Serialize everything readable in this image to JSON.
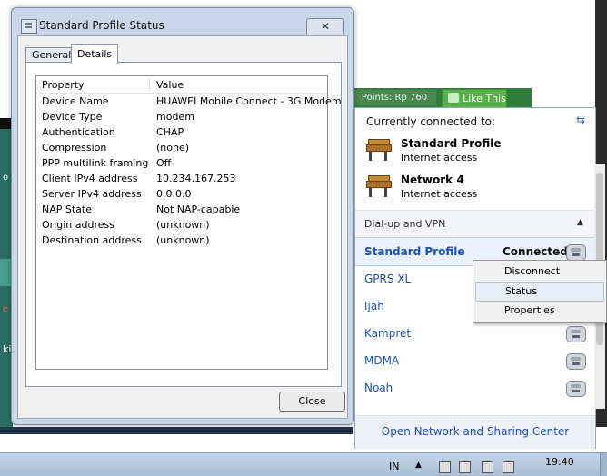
{
  "background": {
    "points_badge": "Points: Rp 760",
    "like_button": "Like This",
    "side_mark_1": "ki",
    "side_mark_2": "o",
    "side_mark_3": "e"
  },
  "dialog": {
    "title": "Standard Profile Status",
    "close_glyph": "✕",
    "tabs": [
      "General",
      "Details"
    ],
    "columns": {
      "property": "Property",
      "value": "Value"
    },
    "rows": [
      {
        "property": "Device Name",
        "value": "HUAWEI Mobile Connect - 3G Modem"
      },
      {
        "property": "Device Type",
        "value": "modem"
      },
      {
        "property": "Authentication",
        "value": "CHAP"
      },
      {
        "property": "Compression",
        "value": "(none)"
      },
      {
        "property": "PPP multilink framing",
        "value": "Off"
      },
      {
        "property": "Client IPv4 address",
        "value": "10.234.167.253"
      },
      {
        "property": "Server IPv4 address",
        "value": "0.0.0.0"
      },
      {
        "property": "NAP State",
        "value": "Not NAP-capable"
      },
      {
        "property": "Origin address",
        "value": "(unknown)"
      },
      {
        "property": "Destination address",
        "value": "(unknown)"
      }
    ],
    "close_label": "Close"
  },
  "flyout": {
    "heading": "Currently connected to:",
    "refresh_glyph": "⇆",
    "networks": [
      {
        "name": "Standard Profile",
        "status": "Internet access"
      },
      {
        "name": "Network  4",
        "status": "Internet access"
      }
    ],
    "section_label": "Dial-up and VPN",
    "section_chevron": "▲",
    "connections": [
      {
        "name": "Standard Profile",
        "status": "Connected"
      },
      {
        "name": "GPRS XL",
        "status": ""
      },
      {
        "name": "Ijah",
        "status": ""
      },
      {
        "name": "Kampret",
        "status": ""
      },
      {
        "name": "MDMA",
        "status": ""
      },
      {
        "name": "Noah",
        "status": ""
      }
    ],
    "footer_link": "Open Network and Sharing Center"
  },
  "context_menu": {
    "items": [
      "Disconnect",
      "Status",
      "Properties"
    ]
  },
  "taskbar": {
    "language": "IN",
    "arrow": "▲",
    "time": "19:40"
  },
  "colors": {
    "accent_link": "#1b51b8",
    "dialog_frame": "#c9d7e8",
    "like_green": "#58b14a"
  }
}
